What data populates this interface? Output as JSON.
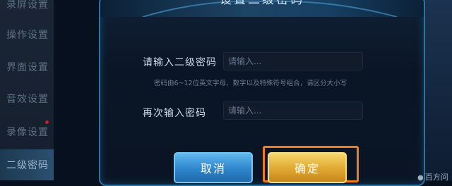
{
  "sidebar": {
    "items": [
      {
        "label": "录屏设置"
      },
      {
        "label": "操作设置"
      },
      {
        "label": "界面设置"
      },
      {
        "label": "音效设置"
      },
      {
        "label": "录像设置"
      },
      {
        "label": "二级密码"
      }
    ],
    "active_index": 5
  },
  "dialog": {
    "title": "设置二级密码",
    "password_label": "请输入二级密码",
    "password_placeholder": "请输入...",
    "hint": "密码由6~12位英文字母、数字以及特殊符号组合，请区分大小写",
    "confirm_label": "再次输入密码",
    "confirm_placeholder": "请输入...",
    "cancel_button": "取消",
    "ok_button": "确定"
  },
  "watermark": {
    "text": "百方问"
  },
  "colors": {
    "accent_blue": "#2f86cc",
    "accent_gold": "#e0a832",
    "highlight_orange": "#f27d1d"
  }
}
